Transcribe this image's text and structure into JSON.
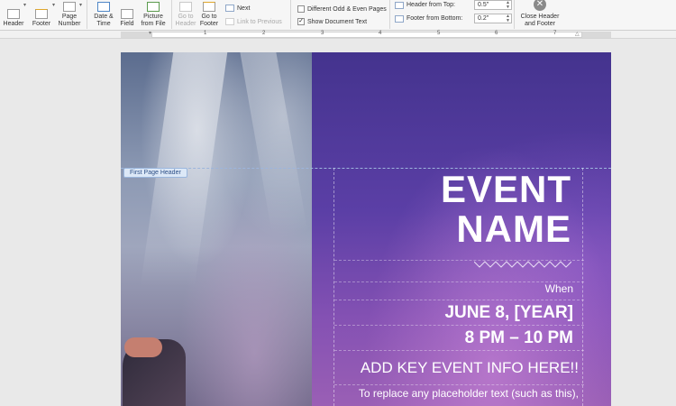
{
  "ribbon": {
    "header_label": "Header",
    "footer_label": "Footer",
    "page_number_label_1": "Page",
    "page_number_label_2": "Number",
    "date_time_label_1": "Date &",
    "date_time_label_2": "Time",
    "field_label": "Field",
    "picture_label_1": "Picture",
    "picture_label_2": "from File",
    "go_to_header_label_1": "Go to",
    "go_to_header_label_2": "Header",
    "go_to_footer_label_1": "Go to",
    "go_to_footer_label_2": "Footer",
    "next_label": "Next",
    "link_previous_label": "Link to Previous",
    "different_odd_even_label": "Different Odd & Even Pages",
    "show_document_text_label": "Show Document Text",
    "show_document_text_checked": true,
    "header_from_top_label": "Header from Top:",
    "header_from_top_value": "0.5\"",
    "footer_from_bottom_label": "Footer from Bottom:",
    "footer_from_bottom_value": "0.2\"",
    "close_label_1": "Close Header",
    "close_label_2": "and Footer"
  },
  "ruler": {
    "numbers": [
      "1",
      "2",
      "3",
      "4",
      "5",
      "6",
      "7"
    ]
  },
  "document": {
    "header_tag": "First Page Header",
    "event_line1": "EVENT",
    "event_line2": "NAME",
    "when_label": "When",
    "date": "JUNE 8, [YEAR]",
    "time": "8 PM – 10 PM",
    "key_info": "ADD KEY EVENT INFO HERE!!",
    "description": "To replace any placeholder text (such as this),"
  },
  "colors": {
    "ribbon_bg": "#f6f6f6",
    "purple_top": "#44338e",
    "purple_bottom": "#9a5fb5",
    "header_tag_bg": "#dce8f7"
  }
}
